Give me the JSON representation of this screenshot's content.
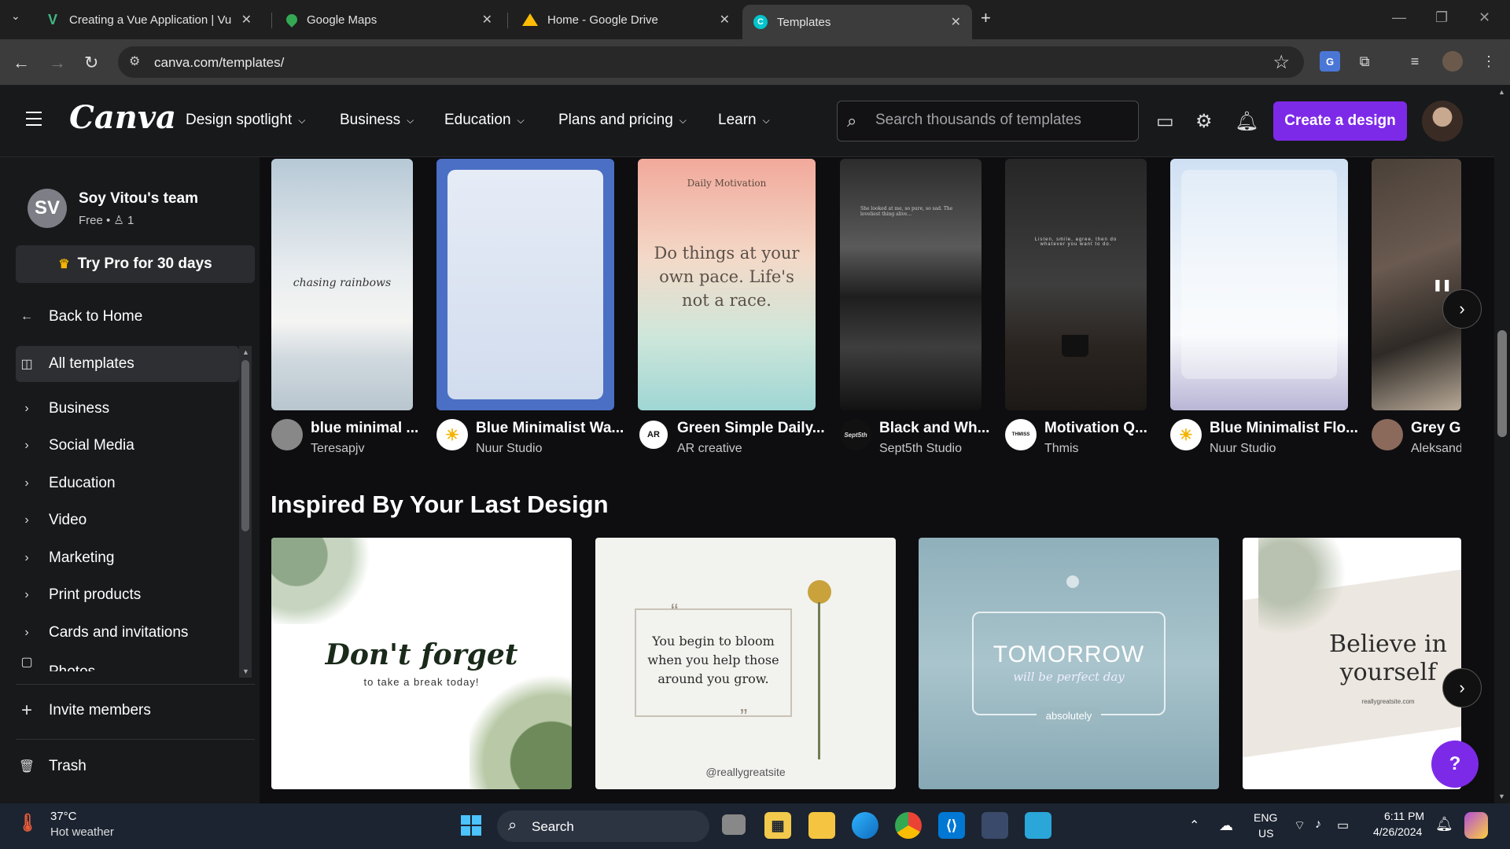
{
  "browser": {
    "tabs": [
      {
        "title": "Creating a Vue Application | Vu",
        "favicon": "vue-icon",
        "color": "#41b883"
      },
      {
        "title": "Google Maps",
        "favicon": "maps-pin-icon",
        "color": "#34a853"
      },
      {
        "title": "Home - Google Drive",
        "favicon": "drive-icon",
        "color": "#fbbc04"
      },
      {
        "title": "Templates",
        "favicon": "canva-icon",
        "color": "#00c4cc"
      }
    ],
    "url": "canva.com/templates/"
  },
  "header": {
    "logo": "Canva",
    "menu": [
      {
        "label": "Design spotlight"
      },
      {
        "label": "Business"
      },
      {
        "label": "Education"
      },
      {
        "label": "Plans and pricing"
      },
      {
        "label": "Learn"
      }
    ],
    "search_placeholder": "Search thousands of templates",
    "create_label": "Create a design",
    "accent_color": "#7d2ae8"
  },
  "sidebar": {
    "team_initials": "SV",
    "team_name": "Soy Vitou's team",
    "team_sub": "Free • ♙ 1",
    "try_pro": "Try Pro for 30 days",
    "back_home": "Back to Home",
    "all_templates": "All templates",
    "categories": [
      "Business",
      "Social Media",
      "Education",
      "Video",
      "Marketing",
      "Print products",
      "Cards and invitations",
      "Photos"
    ],
    "invite": "Invite members",
    "trash": "Trash"
  },
  "templates": [
    {
      "title": "blue minimal ...",
      "author": "Teresapjv",
      "text": "chasing rainbows"
    },
    {
      "title": "Blue Minimalist Wa...",
      "author": "Nuur Studio",
      "text": ""
    },
    {
      "title": "Green Simple Daily...",
      "author": "AR creative",
      "text": "Do things at your own pace. Life's not a race.",
      "heading": "Daily Motivation",
      "avatar_text": "AR"
    },
    {
      "title": "Black and Wh...",
      "author": "Sept5th Studio",
      "text": "She looked at me, so pure, so sad. The loveliest thing alive...",
      "avatar_text": "Sept5th"
    },
    {
      "title": "Motivation Q...",
      "author": "Thmis",
      "text": "Listen, smile, agree, then do whatever you want to do.",
      "avatar_text": "THMISS"
    },
    {
      "title": "Blue Minimalist Flo...",
      "author": "Nuur Studio",
      "text": ""
    },
    {
      "title": "Grey Gr",
      "author": "Aleksand",
      "text": ""
    }
  ],
  "inspired": {
    "title": "Inspired By Your Last Design",
    "cards": [
      {
        "main": "Don't forget",
        "sub": "to take a break today!"
      },
      {
        "main": "You begin to bloom when you help those around you grow.",
        "sub": "@reallygreatsite"
      },
      {
        "main": "TOMORROW",
        "sub": "will be perfect day",
        "tag": "absolutely"
      },
      {
        "main": "Believe in yourself",
        "sub": "reallygreatsite.com"
      }
    ]
  },
  "taskbar": {
    "weather_temp": "37°C",
    "weather_desc": "Hot weather",
    "search": "Search",
    "lang1": "ENG",
    "lang2": "US",
    "time": "6:11 PM",
    "date": "4/26/2024"
  }
}
